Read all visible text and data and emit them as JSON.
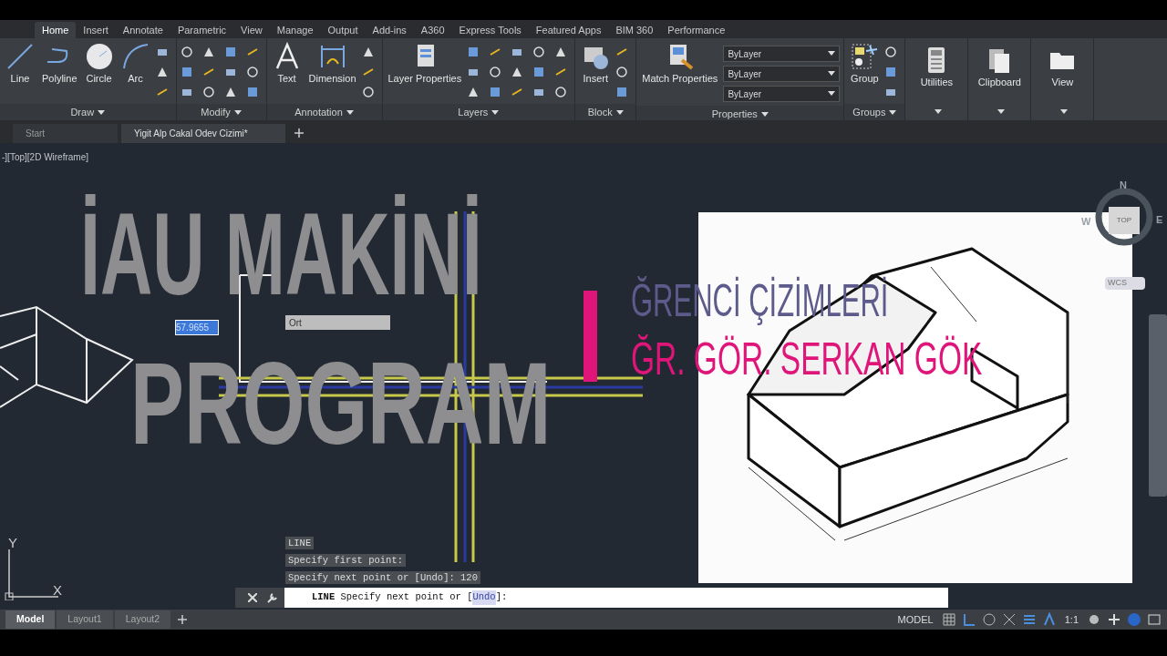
{
  "ribbon_tabs": [
    {
      "label": "Home",
      "selected": true
    },
    {
      "label": "Insert",
      "selected": false
    },
    {
      "label": "Annotate",
      "selected": false
    },
    {
      "label": "Parametric",
      "selected": false
    },
    {
      "label": "View",
      "selected": false
    },
    {
      "label": "Manage",
      "selected": false
    },
    {
      "label": "Output",
      "selected": false
    },
    {
      "label": "Add-ins",
      "selected": false
    },
    {
      "label": "A360",
      "selected": false
    },
    {
      "label": "Express Tools",
      "selected": false
    },
    {
      "label": "Featured Apps",
      "selected": false
    },
    {
      "label": "BIM 360",
      "selected": false
    },
    {
      "label": "Performance",
      "selected": false
    }
  ],
  "panels": [
    {
      "title": "Draw",
      "kind": "tools",
      "tools": [
        {
          "label": "Line",
          "kind": "line"
        },
        {
          "label": "Polyline",
          "kind": "polyline"
        },
        {
          "label": "Circle",
          "kind": "circle"
        },
        {
          "label": "Arc",
          "kind": "arc"
        }
      ]
    },
    {
      "title": "Modify",
      "kind": "tools"
    },
    {
      "title": "Annotation",
      "kind": "tools",
      "tools": [
        {
          "label": "Text",
          "kind": "text"
        },
        {
          "label": "Dimension",
          "kind": "dimension"
        }
      ]
    },
    {
      "title": "Layers",
      "kind": "tools",
      "tools": [
        {
          "label": "Layer Properties",
          "kind": "layers"
        }
      ]
    },
    {
      "title": "Block",
      "kind": "tools",
      "tools": [
        {
          "label": "Insert",
          "kind": "insert"
        }
      ]
    },
    {
      "title": "Properties",
      "kind": "properties",
      "tools": [
        {
          "label": "Match Properties",
          "kind": "match"
        }
      ],
      "dropdowns": [
        "ByLayer",
        "ByLayer",
        "ByLayer"
      ]
    },
    {
      "title": "Groups",
      "kind": "tools",
      "tools": [
        {
          "label": "Group",
          "kind": "group"
        }
      ]
    },
    {
      "kind": "collapsed",
      "tools": [
        {
          "label": "Utilities",
          "kind": "calculator"
        }
      ]
    },
    {
      "kind": "collapsed",
      "tools": [
        {
          "label": "Clipboard",
          "kind": "clipboard"
        }
      ]
    },
    {
      "kind": "collapsed",
      "tools": [
        {
          "label": "View",
          "kind": "folder"
        }
      ]
    }
  ],
  "document_tabs": [
    {
      "label": "Start",
      "selected": false
    },
    {
      "label": "Yigit Alp Cakal Odev Cizimi*",
      "selected": true
    }
  ],
  "viewport_label": "-][Top][2D Wireframe]",
  "overlay": {
    "title_lines": [
      "İAU MAKİNİ",
      "PROGRAM"
    ],
    "subtitle_lines": [
      {
        "text": "ĞRENCİ ÇİZİMLERİ",
        "color": "#5d5a8c"
      },
      {
        "text": "ĞR. GÖR. SERKAN GÖK",
        "color": "#e0157a"
      }
    ]
  },
  "dynamic_input": {
    "value": "57.9655"
  },
  "tooltip": "Ort",
  "reference_image": {
    "kind": "picture"
  },
  "viewcube": {
    "north": "N",
    "east": "E",
    "west": "W",
    "face": "TOP",
    "ucs": "WCS"
  },
  "command_history": [
    "LINE",
    "Specify first point:",
    "Specify next point or [Undo]: 120"
  ],
  "command_line": {
    "command": "LINE",
    "prompt": "Specify next point or [",
    "option": "Undo",
    "suffix": "]:"
  },
  "ucs_axes": {
    "y": "Y",
    "x": "X"
  },
  "layout_tabs": [
    {
      "label": "Model",
      "selected": true
    },
    {
      "label": "Layout1",
      "selected": false
    },
    {
      "label": "Layout2",
      "selected": false
    }
  ],
  "status_bar": {
    "space": "MODEL",
    "scale": "1:1"
  }
}
